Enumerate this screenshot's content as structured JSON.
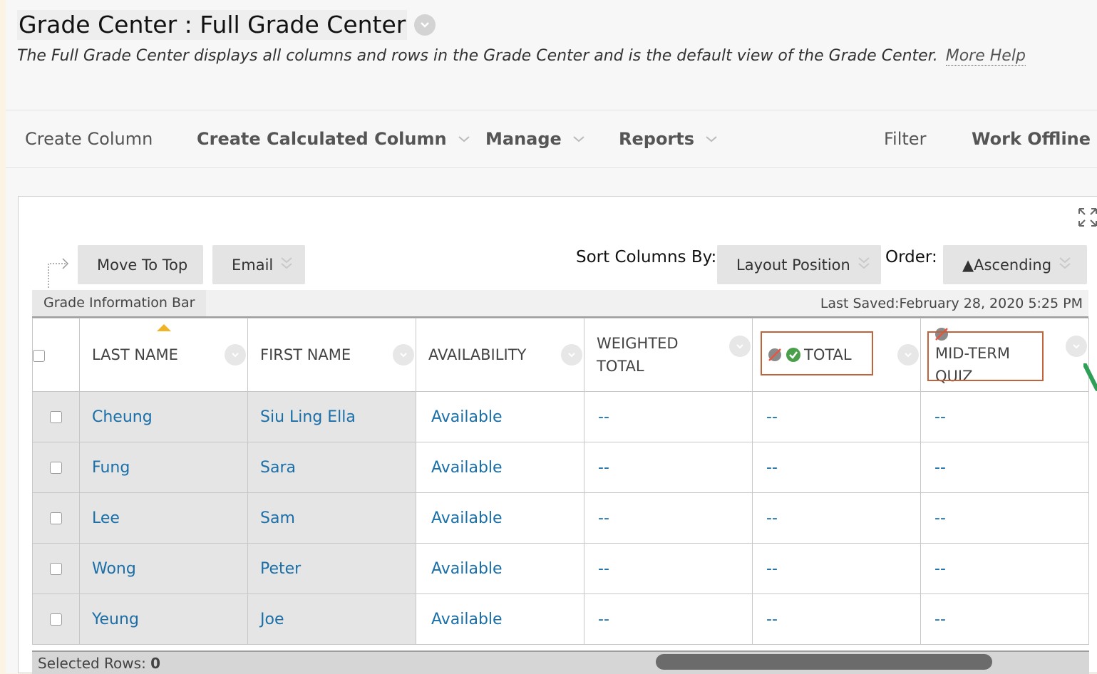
{
  "page": {
    "title": "Grade Center : Full Grade Center",
    "description": "The Full Grade Center displays all columns and rows in the Grade Center and is the default view of the Grade Center.",
    "more_help": "More Help"
  },
  "toolbar": {
    "create_column": "Create Column",
    "create_calculated_column": "Create Calculated Column",
    "manage": "Manage",
    "reports": "Reports",
    "filter": "Filter",
    "work_offline": "Work Offline"
  },
  "controls": {
    "move_to_top": "Move To Top",
    "email": "Email",
    "sort_columns_by_label": "Sort Columns By:",
    "sort_columns_by_value": "Layout Position",
    "order_label": "Order:",
    "order_value": "▲Ascending"
  },
  "info_bar": {
    "tab": "Grade Information Bar",
    "last_saved": "Last Saved:February 28, 2020 5:25 PM"
  },
  "columns": [
    "LAST NAME",
    "FIRST NAME",
    "AVAILABILITY",
    "WEIGHTED TOTAL",
    "TOTAL",
    "MID-TERM QUIZ"
  ],
  "rows": [
    {
      "last": "Cheung",
      "first": "Siu Ling Ella",
      "availability": "Available",
      "weighted": "--",
      "total": "--",
      "midterm": "--"
    },
    {
      "last": "Fung",
      "first": "Sara",
      "availability": "Available",
      "weighted": "--",
      "total": "--",
      "midterm": "--"
    },
    {
      "last": "Lee",
      "first": "Sam",
      "availability": "Available",
      "weighted": "--",
      "total": "--",
      "midterm": "--"
    },
    {
      "last": "Wong",
      "first": "Peter",
      "availability": "Available",
      "weighted": "--",
      "total": "--",
      "midterm": "--"
    },
    {
      "last": "Yeung",
      "first": "Joe",
      "availability": "Available",
      "weighted": "--",
      "total": "--",
      "midterm": "--"
    }
  ],
  "footer": {
    "selected_rows_label": "Selected Rows:",
    "selected_rows_count": "0"
  },
  "colors": {
    "link": "#1a6fa8",
    "highlight_box": "#c0633b",
    "sort_arrow": "#f0b429",
    "annotation_arrow": "#2f9e57"
  }
}
